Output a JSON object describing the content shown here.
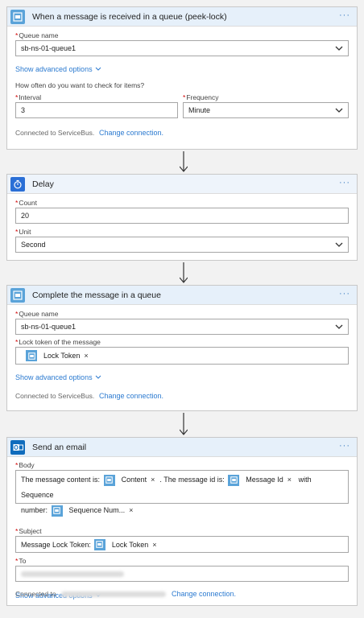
{
  "card1": {
    "title": "When a message is received in a queue (peek-lock)",
    "queue_label": "Queue name",
    "queue_value": "sb-ns-01-queue1",
    "advanced": "Show advanced options",
    "question": "How often do you want to check for items?",
    "interval_label": "Interval",
    "interval_value": "3",
    "frequency_label": "Frequency",
    "frequency_value": "Minute",
    "connected": "Connected to ServiceBus.",
    "change": "Change connection."
  },
  "card2": {
    "title": "Delay",
    "count_label": "Count",
    "count_value": "20",
    "unit_label": "Unit",
    "unit_value": "Second"
  },
  "card3": {
    "title": "Complete the message in a queue",
    "queue_label": "Queue name",
    "queue_value": "sb-ns-01-queue1",
    "lock_label": "Lock token of the message",
    "lock_token": "Lock Token",
    "advanced": "Show advanced options",
    "connected": "Connected to ServiceBus.",
    "change": "Change connection."
  },
  "card4": {
    "title": "Send an email",
    "body_label": "Body",
    "body_text1": "The message content is:",
    "token_content": "Content",
    "body_text2": ". The message id is:",
    "token_message_id": "Message Id",
    "body_text3": "with Sequence",
    "body_text4": "number:",
    "token_sequence": "Sequence Num...",
    "subject_label": "Subject",
    "subject_text": "Message Lock Token:",
    "token_lock": "Lock Token",
    "to_label": "To",
    "advanced": "Show advanced options",
    "connected": "Connected to",
    "change": "Change connection."
  },
  "colors": {
    "accent": "#2b7ad0",
    "servicebus_icon": "#5aa3d9",
    "delay_icon": "#2a6fd6",
    "outlook_icon": "#0f6cbd",
    "required": "#d00000"
  }
}
